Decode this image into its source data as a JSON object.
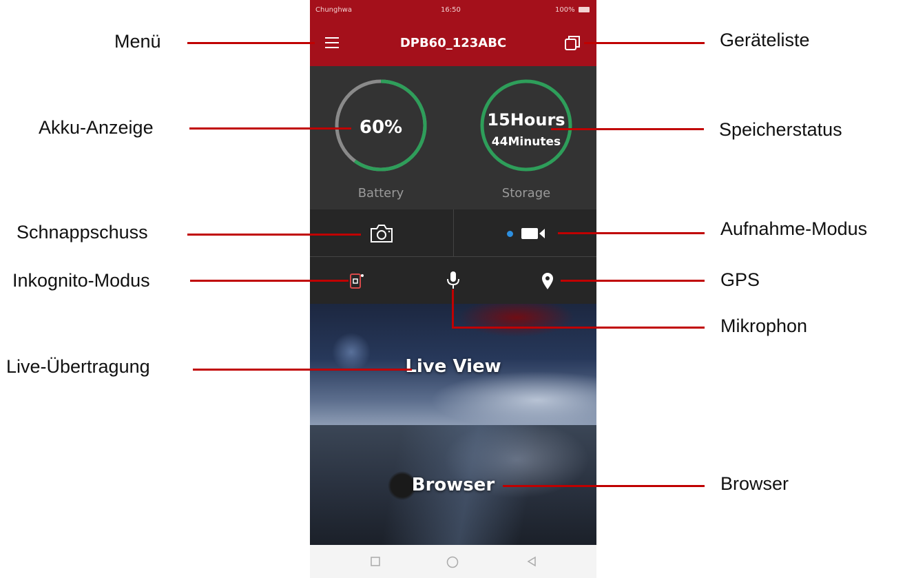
{
  "annotations": {
    "menu": "Menü",
    "device_list": "Geräteliste",
    "battery_display": "Akku-Anzeige",
    "storage_status": "Speicherstatus",
    "snapshot": "Schnappschuss",
    "recording_mode": "Aufnahme-Modus",
    "incognito_mode": "Inkognito-Modus",
    "gps": "GPS",
    "microphone": "Mikrophon",
    "live_transmission": "Live-Übertragung",
    "browser": "Browser"
  },
  "statusbar": {
    "carrier": "Chunghwa",
    "time": "16:50",
    "battery": "100%"
  },
  "appbar": {
    "title": "DPB60_123ABC"
  },
  "battery": {
    "value_text": "60%",
    "level": 0.6,
    "caption": "Battery"
  },
  "storage": {
    "hours": "15Hours",
    "minutes": "44Minutes",
    "caption": "Storage"
  },
  "tiles": {
    "live": "Live View",
    "browser": "Browser"
  },
  "colors": {
    "accent": "#a4101b",
    "ring_active": "#2e9e5a",
    "ring_inactive": "#8a8a8a",
    "annotation_line": "#c00000",
    "record_dot": "#2d8fe0"
  },
  "icons": [
    "menu-icon",
    "device-list-icon",
    "camera-icon",
    "record-dot-icon",
    "video-camera-icon",
    "incognito-icon",
    "microphone-icon",
    "location-pin-icon",
    "square-nav-icon",
    "circle-nav-icon",
    "back-nav-icon"
  ]
}
